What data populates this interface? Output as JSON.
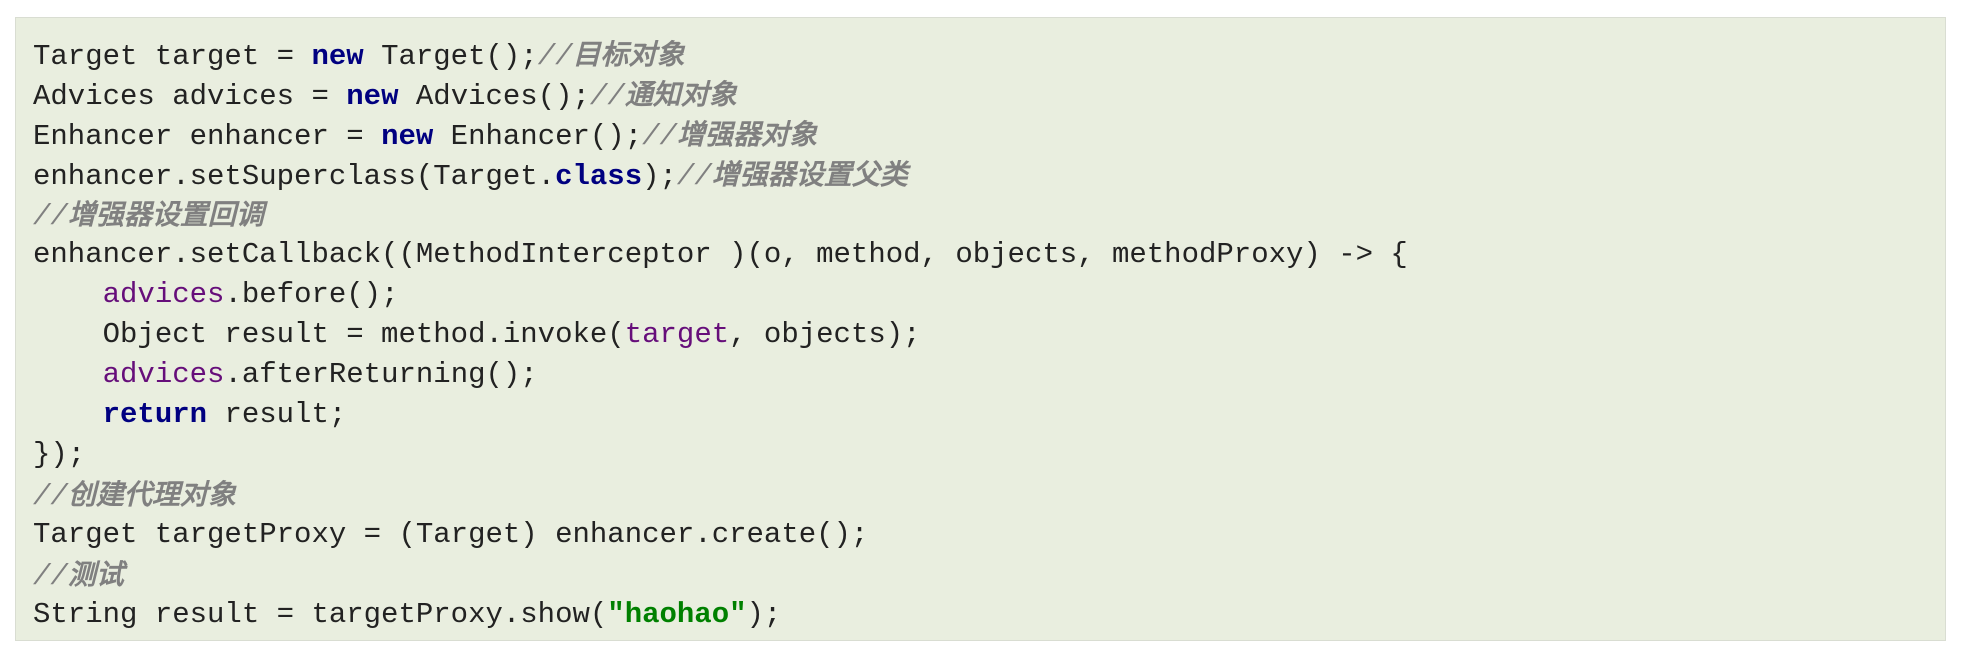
{
  "code_block": {
    "lines": [
      [
        {
          "text": "Target target = ",
          "style": "plain"
        },
        {
          "text": "new",
          "style": "keyword"
        },
        {
          "text": " Target();",
          "style": "plain"
        },
        {
          "text": "//",
          "style": "comment"
        },
        {
          "text": "目标对象",
          "style": "comment-cjk"
        }
      ],
      [
        {
          "text": "Advices advices = ",
          "style": "plain"
        },
        {
          "text": "new",
          "style": "keyword"
        },
        {
          "text": " Advices();",
          "style": "plain"
        },
        {
          "text": "//",
          "style": "comment"
        },
        {
          "text": "通知对象",
          "style": "comment-cjk"
        }
      ],
      [
        {
          "text": "Enhancer enhancer = ",
          "style": "plain"
        },
        {
          "text": "new",
          "style": "keyword"
        },
        {
          "text": " Enhancer();",
          "style": "plain"
        },
        {
          "text": "//",
          "style": "comment"
        },
        {
          "text": "增强器对象",
          "style": "comment-cjk"
        }
      ],
      [
        {
          "text": "enhancer.setSuperclass(Target.",
          "style": "plain"
        },
        {
          "text": "class",
          "style": "keyword"
        },
        {
          "text": ");",
          "style": "plain"
        },
        {
          "text": "//",
          "style": "comment"
        },
        {
          "text": "增强器设置父类",
          "style": "comment-cjk"
        }
      ],
      [
        {
          "text": "//",
          "style": "comment"
        },
        {
          "text": "增强器设置回调",
          "style": "comment-cjk"
        }
      ],
      [
        {
          "text": "enhancer.setCallback((MethodInterceptor )(o, method, objects, methodProxy) -> {",
          "style": "plain"
        }
      ],
      [
        {
          "text": "    ",
          "style": "plain"
        },
        {
          "text": "advices",
          "style": "field"
        },
        {
          "text": ".before();",
          "style": "plain"
        }
      ],
      [
        {
          "text": "    Object result = method.invoke(",
          "style": "plain"
        },
        {
          "text": "target",
          "style": "field"
        },
        {
          "text": ", objects);",
          "style": "plain"
        }
      ],
      [
        {
          "text": "    ",
          "style": "plain"
        },
        {
          "text": "advices",
          "style": "field"
        },
        {
          "text": ".afterReturning();",
          "style": "plain"
        }
      ],
      [
        {
          "text": "    ",
          "style": "plain"
        },
        {
          "text": "return",
          "style": "keyword"
        },
        {
          "text": " result;",
          "style": "plain"
        }
      ],
      [
        {
          "text": "});",
          "style": "plain"
        }
      ],
      [
        {
          "text": "//",
          "style": "comment"
        },
        {
          "text": "创建代理对象",
          "style": "comment-cjk"
        }
      ],
      [
        {
          "text": "Target targetProxy = (Target) enhancer.create();",
          "style": "plain"
        }
      ],
      [
        {
          "text": "//",
          "style": "comment"
        },
        {
          "text": "测试",
          "style": "comment-cjk"
        }
      ],
      [
        {
          "text": "String result = targetProxy.show(",
          "style": "plain"
        },
        {
          "text": "\"haohao\"",
          "style": "string"
        },
        {
          "text": ");",
          "style": "plain"
        }
      ]
    ]
  },
  "colors": {
    "background": "#e9eedf",
    "border": "#d9ddd2",
    "text": "#222222",
    "keyword": "#000080",
    "field": "#660e7a",
    "string": "#008000",
    "comment": "#808080"
  }
}
